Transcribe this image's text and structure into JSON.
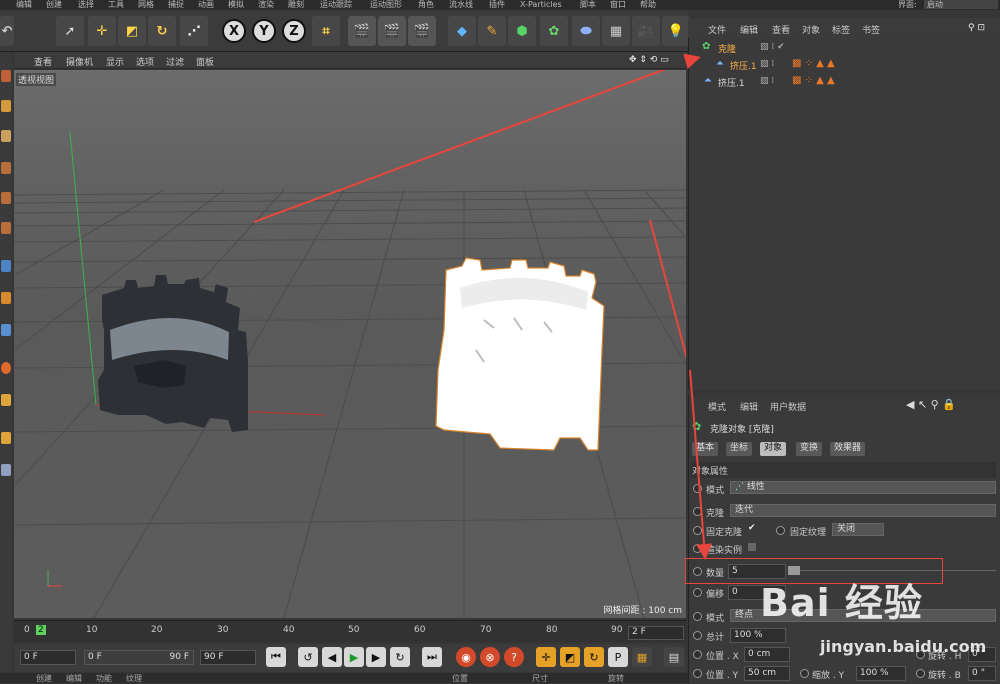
{
  "menubar": {
    "items": [
      "编辑",
      "创建",
      "选择",
      "工具",
      "网格",
      "捕捉",
      "动画",
      "模拟",
      "渲染",
      "雕刻",
      "运动跟踪",
      "运动图形",
      "角色",
      "流水线",
      "插件",
      "X-Particles",
      "脚本",
      "窗口",
      "帮助"
    ],
    "interface_label": "界面:",
    "interface_value": "启动"
  },
  "toolbar": {
    "axis_x": "X",
    "axis_y": "Y",
    "axis_z": "Z"
  },
  "viewport": {
    "menu": [
      "查看",
      "摄像机",
      "显示",
      "选项",
      "过滤",
      "面板"
    ],
    "label": "透视视图",
    "grid_info": "网格间距 : 100 cm"
  },
  "timeline": {
    "ticks": [
      "0",
      "2",
      "10",
      "20",
      "30",
      "40",
      "50",
      "60",
      "70",
      "80",
      "90"
    ],
    "frame_field": "2 F"
  },
  "transport": {
    "start": "0 F",
    "range_start": "0 F",
    "range_end": "90 F",
    "end": "90 F"
  },
  "bottombar": {
    "items": [
      "创建",
      "编辑",
      "功能",
      "纹理",
      "位置",
      "尺寸",
      "旋转"
    ]
  },
  "object_manager": {
    "menu": [
      "文件",
      "编辑",
      "查看",
      "对象",
      "标签",
      "书签"
    ],
    "objects": [
      {
        "name": "克隆",
        "level": 0
      },
      {
        "name": "挤压.1",
        "level": 1
      },
      {
        "name": "挤压.1",
        "level": 0
      }
    ]
  },
  "attributes": {
    "menu": [
      "模式",
      "编辑",
      "用户数据"
    ],
    "title": "克隆对象 [克隆]",
    "tabs": [
      "基本",
      "坐标",
      "对象",
      "变换",
      "效果器"
    ],
    "active_tab": "对象",
    "section": "对象属性",
    "mode_label": "模式",
    "mode_value": "线性",
    "clone_label": "克隆",
    "clone_value": "迭代",
    "fix_clone": "固定克隆",
    "fix_texture": "固定纹理",
    "fix_texture_value": "关闭",
    "render_instances": "渲染实例",
    "count_label": "数量",
    "count_value": "5",
    "offset_label": "偏移",
    "offset_value": "0",
    "mode2_label": "模式",
    "mode2_value": "终点",
    "total_label": "总计",
    "total_value": "100 %",
    "pos_label": "位置 . X",
    "pos_x": "0 cm",
    "pos_y_label": "位置 . Y",
    "pos_y": "50 cm",
    "scale_y_label": "缩放 . Y",
    "scale_y": "100 %",
    "rot_h_label": "旋转 . H",
    "rot_h": "0 °",
    "rot_b_label": "旋转 . B",
    "rot_b": "0 °"
  },
  "watermark": {
    "brand": "Bai 经验",
    "url": "jingyan.baidu.com"
  },
  "colors": {
    "accent_red": "#e8453c",
    "highlight_orange": "#e5a226",
    "bg": "#3a3a3a"
  }
}
